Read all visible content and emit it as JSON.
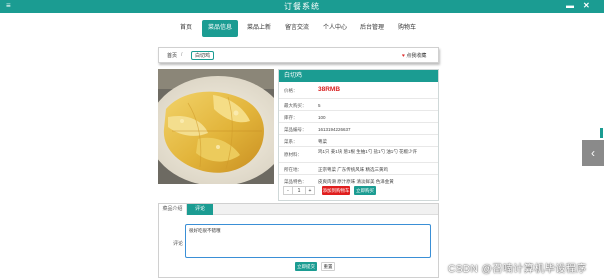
{
  "app": {
    "title": "订餐系统"
  },
  "nav": {
    "items": [
      {
        "label": "首页",
        "active": false
      },
      {
        "label": "菜品信息",
        "active": true
      },
      {
        "label": "菜品上新",
        "active": false
      },
      {
        "label": "留言交流",
        "active": false
      },
      {
        "label": "个人中心",
        "active": false
      },
      {
        "label": "后台管理",
        "active": false
      },
      {
        "label": "购物车",
        "active": false
      }
    ]
  },
  "breadcrumb": {
    "home": "首页",
    "separator": "/",
    "current": "白切鸡",
    "favorite": "点我收藏"
  },
  "detail": {
    "name": "白切鸡",
    "rows": [
      {
        "label": "价格：",
        "value": "38RMB",
        "emphasis": true
      },
      {
        "label": "最大购买：",
        "value": "5"
      },
      {
        "label": "库存：",
        "value": "100"
      },
      {
        "label": "菜品编号：",
        "value": "1613194226637"
      },
      {
        "label": "菜系：",
        "value": "粤菜"
      },
      {
        "label": "原材料：",
        "value": "鸡1只 姜1块 葱1根 生抽1勺 盐1勺 油1勺 花椒少许"
      },
      {
        "label": "所在地：",
        "value": "正宗粤菜 广东传统风味 精选三黄鸡"
      },
      {
        "label": "菜品特色：",
        "value": "皮爽肉滑 原汁原味 清淡鲜美 色泽金黄"
      }
    ],
    "quantity": {
      "minus": "-",
      "value": "1",
      "plus": "+"
    },
    "add_to_cart": "添加到购物车",
    "buy_now": "立即购买"
  },
  "comments": {
    "tabs": [
      {
        "label": "菜品介绍"
      },
      {
        "label": "评论"
      }
    ],
    "field_label": "评论",
    "value": "很好吃很不错哦",
    "submit": "立即提交",
    "reset": "重置"
  },
  "watermark": "CSDN @召喃计算机毕设程序",
  "colors": {
    "accent": "#1b9c92",
    "price": "#d81e1e",
    "cart_button": "#e01e1e"
  }
}
